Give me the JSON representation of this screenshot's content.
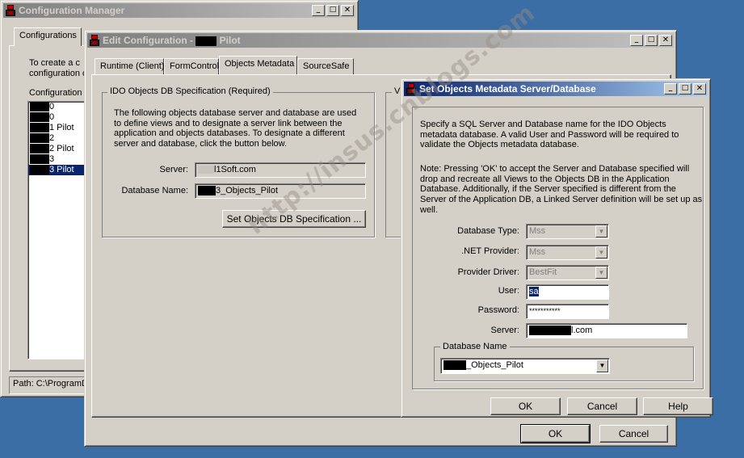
{
  "config_manager": {
    "title": "Configuration Manager",
    "tabs": [
      "Configurations"
    ],
    "intro_line1": "To create a c",
    "intro_line2": "configuration c",
    "list_label": "Configuration N",
    "list_items": [
      {
        "text": "0",
        "selected": false
      },
      {
        "text": "0",
        "selected": false
      },
      {
        "text": "1 Pilot",
        "selected": false
      },
      {
        "text": "2",
        "selected": false
      },
      {
        "text": "2 Pilot",
        "selected": false
      },
      {
        "text": "3",
        "selected": false
      },
      {
        "text": "3 Pilot",
        "selected": true
      }
    ],
    "path_status": "Path: C:\\ProgramD"
  },
  "edit_config": {
    "title_prefix": "Edit Configuration - ",
    "title_suffix": " Pilot",
    "tabs": [
      "Runtime (Client)",
      "FormControl",
      "Objects Metadata",
      "SourceSafe"
    ],
    "active_tab": "Objects Metadata",
    "group_title": "IDO Objects DB Specification (Required)",
    "description": "The following objects database server and database are used to define views and to designate a server link between the application and objects databases. To designate a different server and database, click the button below.",
    "server_label": "Server:",
    "server_value": "l1Soft.com",
    "db_label": "Database Name:",
    "db_value": "3_Objects_Pilot",
    "set_button": "Set Objects DB Specification ...",
    "second_group_initial": "V",
    "ok": "OK",
    "cancel": "Cancel"
  },
  "set_metadata": {
    "title": "Set Objects Metadata Server/Database",
    "para1": "Specify a SQL Server and Database name for the IDO Objects metadata database.  A valid User and Password will be required to validate the Objects metadata database.",
    "para2": "Note: Pressing 'OK' to accept the Server and Database specified will drop and recreate all Views to the Objects DB in the Application Database. Additionally, if the Server specified is different from the Server of the Application DB, a Linked Server definition will be set up as well.",
    "db_type_label": "Database Type:",
    "db_type_value": "Mss",
    "net_provider_label": ".NET Provider:",
    "net_provider_value": "Mss",
    "provider_driver_label": "Provider Driver:",
    "provider_driver_value": "BestFit",
    "user_label": "User:",
    "user_value": "sa",
    "password_label": "Password:",
    "password_value": "***********",
    "server_label": "Server:",
    "server_value": "l.com",
    "dbname_group": "Database Name",
    "dbname_value": "_Objects_Pilot",
    "ok": "OK",
    "cancel": "Cancel",
    "help": "Help"
  },
  "watermark": "http://insus.cnblogs.com"
}
